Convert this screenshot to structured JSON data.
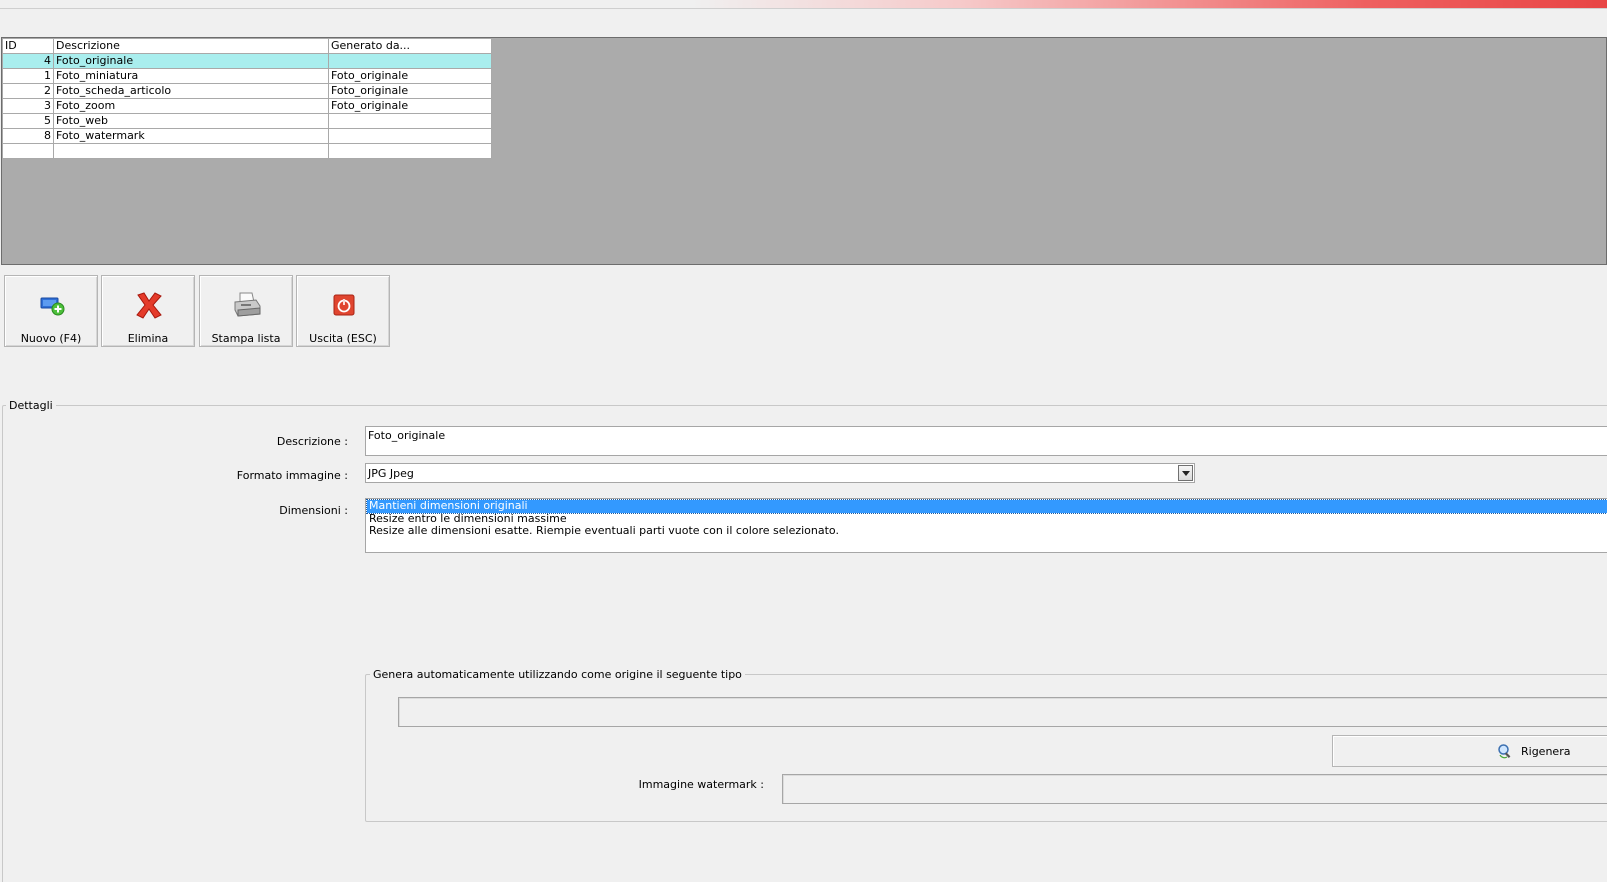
{
  "grid": {
    "columns": [
      "ID",
      "Descrizione",
      "Generato da..."
    ],
    "rows": [
      {
        "id": "4",
        "descrizione": "Foto_originale",
        "generato": ""
      },
      {
        "id": "1",
        "descrizione": "Foto_miniatura",
        "generato": "Foto_originale"
      },
      {
        "id": "2",
        "descrizione": "Foto_scheda_articolo",
        "generato": "Foto_originale"
      },
      {
        "id": "3",
        "descrizione": "Foto_zoom",
        "generato": "Foto_originale"
      },
      {
        "id": "5",
        "descrizione": "Foto_web",
        "generato": ""
      },
      {
        "id": "8",
        "descrizione": "Foto_watermark",
        "generato": ""
      },
      {
        "id": "",
        "descrizione": "",
        "generato": ""
      }
    ],
    "selected_row": 0
  },
  "toolbar": {
    "nuovo": "Nuovo (F4)",
    "elimina": "Elimina",
    "stampa": "Stampa lista",
    "uscita": "Uscita (ESC)"
  },
  "details": {
    "title": "Dettagli",
    "descrizione_label": "Descrizione :",
    "descrizione_value": "Foto_originale",
    "formato_label": "Formato immagine :",
    "formato_value": "JPG Jpeg",
    "dimensioni_label": "Dimensioni :",
    "dimensioni_options": [
      "Mantieni dimensioni originali",
      "Resize entro le dimensioni massime",
      "Resize alle dimensioni esatte. Riempie eventuali parti vuote con il colore selezionato."
    ],
    "dimensioni_selected": 0,
    "genera_title": "Genera automaticamente utilizzando come origine il seguente tipo",
    "rigenera_label": "Rigenera",
    "watermark_label": "Immagine watermark :"
  },
  "colors": {
    "selected_row": "#a9eeee",
    "list_selection": "#3399ff",
    "grid_background": "#ababab"
  }
}
